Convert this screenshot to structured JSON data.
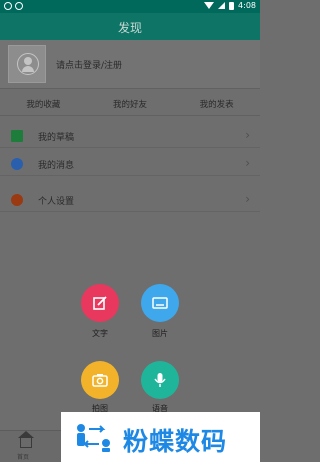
{
  "status_bar": {
    "time": "4:08"
  },
  "app_bar": {
    "title": "发现"
  },
  "profile": {
    "login_text": "请点击登录/注册"
  },
  "tabs": [
    {
      "label": "我的收藏"
    },
    {
      "label": "我的好友"
    },
    {
      "label": "我的发表"
    }
  ],
  "menu": [
    {
      "label": "我的草稿",
      "icon": "draft-icon"
    },
    {
      "label": "我的消息",
      "icon": "message-icon"
    },
    {
      "label": "个人设置",
      "icon": "settings-icon"
    }
  ],
  "actions": [
    {
      "label": "文字",
      "icon": "edit-icon",
      "color": "#e9385d"
    },
    {
      "label": "图片",
      "icon": "image-icon",
      "color": "#3fa8ec"
    },
    {
      "label": "拍图",
      "icon": "camera-icon",
      "color": "#f2b32a"
    },
    {
      "label": "语音",
      "icon": "microphone-icon",
      "color": "#1fb59a"
    }
  ],
  "bottom_nav": {
    "home_label": "首页"
  },
  "watermark": {
    "text": "粉蝶数码"
  },
  "colors": {
    "primary": "#0e7466",
    "status": "#00695c",
    "accent_text": "#1e88e5"
  }
}
